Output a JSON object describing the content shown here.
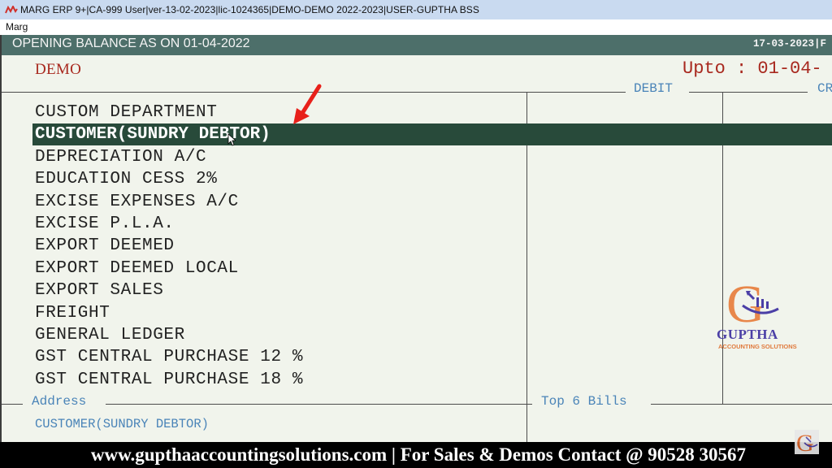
{
  "window": {
    "title": "MARG ERP 9+|CA-999 User|ver-13-02-2023|lic-1024365|DEMO-DEMO 2022-2023|USER-GUPTHA BSS",
    "app_icon": "marg-logo-icon"
  },
  "menu": {
    "items": [
      "Marg"
    ]
  },
  "header": {
    "title": "OPENING BALANCE AS ON 01-04-2022",
    "date": "17-03-2023|F"
  },
  "company": {
    "name": "DEMO",
    "upto": "Upto : 01-04-"
  },
  "columns": {
    "debit": "DEBIT",
    "credit": "CR"
  },
  "ledgers": [
    {
      "name": "CUSTOM DEPARTMENT",
      "selected": false
    },
    {
      "name": "CUSTOMER(SUNDRY DEBTOR)",
      "selected": true
    },
    {
      "name": "DEPRECIATION A/C",
      "selected": false
    },
    {
      "name": "EDUCATION CESS 2%",
      "selected": false
    },
    {
      "name": "EXCISE EXPENSES A/C",
      "selected": false
    },
    {
      "name": "EXCISE P.L.A.",
      "selected": false
    },
    {
      "name": "EXPORT DEEMED",
      "selected": false
    },
    {
      "name": "EXPORT DEEMED LOCAL",
      "selected": false
    },
    {
      "name": "EXPORT SALES",
      "selected": false
    },
    {
      "name": "FREIGHT",
      "selected": false
    },
    {
      "name": "GENERAL LEDGER",
      "selected": false
    },
    {
      "name": "GST CENTRAL PURCHASE 12 %",
      "selected": false
    },
    {
      "name": "GST CENTRAL PURCHASE 18 %",
      "selected": false
    }
  ],
  "bottom": {
    "address_label": "Address",
    "address_value": "CUSTOMER(SUNDRY DEBTOR)",
    "top_bills_label": "Top 6 Bills"
  },
  "watermark": {
    "name": "GUPTHA",
    "subtitle": "ACCOUNTING SOLUTIONS"
  },
  "footer": {
    "text": "www.gupthaaccountingsolutions.com | For Sales & Demos Contact @ 90528 30567"
  },
  "colors": {
    "header_bg": "#4d6f6a",
    "selection_bg": "#284a3a",
    "company_red": "#a8281e",
    "label_blue": "#4a84b8",
    "annotation_arrow": "#e8201a"
  }
}
